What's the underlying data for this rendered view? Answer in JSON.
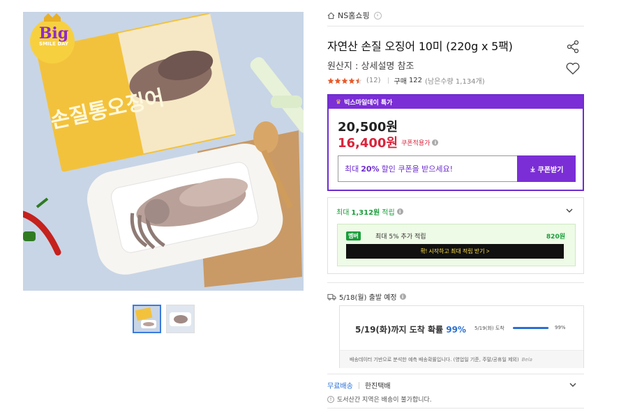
{
  "seller": {
    "home_icon": "home-icon",
    "name": "NS홈쇼핑"
  },
  "product": {
    "title": "자연산 손질 오징어 10미 (220g x 5팩)",
    "origin": "원산지 : 상세설명 참조",
    "rating": 4.5,
    "review_count": "(12)",
    "buy_label": "구매",
    "buy_count": "122",
    "remaining": "(남은수량 1,134개)"
  },
  "image": {
    "badge_big": "Big",
    "badge_sub": "SMILE DAY",
    "package_text": "손질통오징어"
  },
  "deal": {
    "header": "빅스마일데이 특가",
    "original_price": "20,500원",
    "sale_price": "16,400원",
    "coupon_note": "쿠폰적용가",
    "coupon_promo_prefix": "최대",
    "coupon_promo_pct": "20%",
    "coupon_promo_suffix": "할인 쿠폰을 받으세요!",
    "coupon_button": "쿠폰받기",
    "accent": "#7b2ed6",
    "sale_color": "#d9243c"
  },
  "points": {
    "prefix": "최대",
    "amount": "1,312원",
    "suffix": "적립",
    "member_badge": "멤버",
    "member_text": "최대 5% 추가 적립",
    "member_amount": "820원",
    "member_cta": "확! 시작하고 최대 적립 받기 >"
  },
  "shipping": {
    "dispatch": "5/18(월) 출발 예정",
    "arrival_main": "5/19(화)까지 도착 확률",
    "arrival_pct": "99%",
    "bar_label": "5/19(화) 도착",
    "bar_value": 0.99,
    "bar_pct": "99%",
    "footnote": "배송데이터 기반으로 분석한 예측 배송확률입니다. (영업일 기준, 주말/공휴일 제외)",
    "footnote_brand": "Bela",
    "free_label": "무료배송",
    "courier": "한진택배",
    "notice": "도서산간 지역은 배송이 불가합니다."
  }
}
